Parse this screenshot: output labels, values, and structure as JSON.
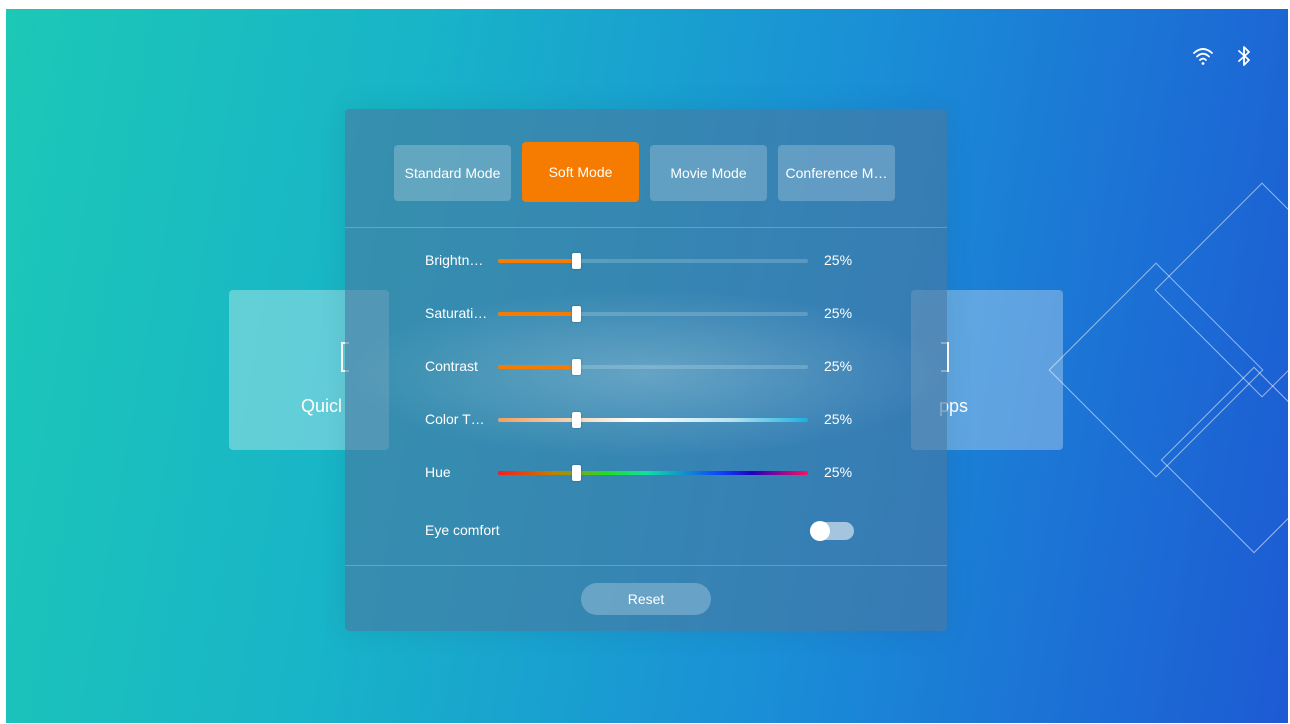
{
  "status_bar": {
    "wifi_icon": "wifi-icon",
    "bluetooth_icon": "bluetooth-icon"
  },
  "background_tiles": {
    "left_label": "Quicl",
    "right_label": "pps"
  },
  "picture_panel": {
    "modes": [
      {
        "label": "Standard Mode",
        "active": false
      },
      {
        "label": "Soft Mode",
        "active": true
      },
      {
        "label": "Movie Mode",
        "active": false
      },
      {
        "label": "Conference M…",
        "active": false
      }
    ],
    "sliders": [
      {
        "label": "Brightn…",
        "value_text": "25%",
        "level": 0.25,
        "style": "plain"
      },
      {
        "label": "Saturati…",
        "value_text": "25%",
        "level": 0.25,
        "style": "plain"
      },
      {
        "label": "Contrast",
        "value_text": "25%",
        "level": 0.25,
        "style": "plain"
      },
      {
        "label": "Color T…",
        "value_text": "25%",
        "level": 0.25,
        "style": "temperature"
      },
      {
        "label": "Hue",
        "value_text": "25%",
        "level": 0.25,
        "style": "hue"
      }
    ],
    "eye_comfort": {
      "label": "Eye comfort",
      "enabled": false
    },
    "reset_label": "Reset"
  },
  "colors": {
    "accent": "#f57c00",
    "background_start": "#1cc8b6",
    "background_end": "#1d5ad4"
  }
}
